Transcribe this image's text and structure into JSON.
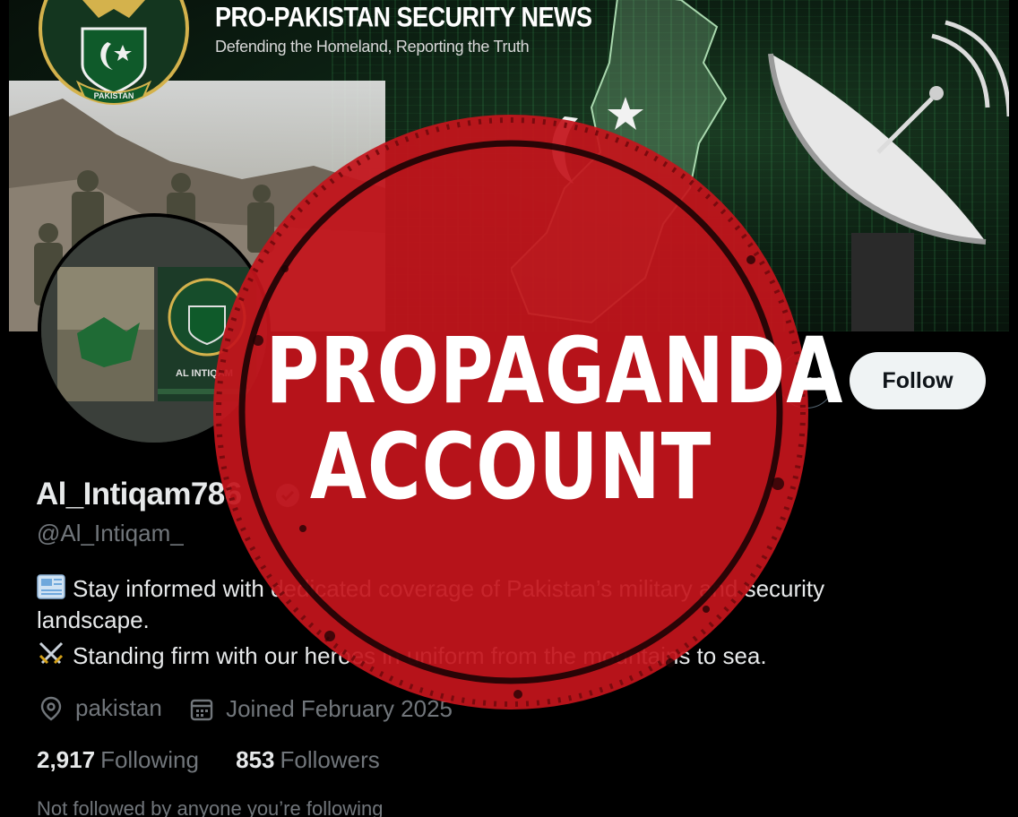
{
  "banner": {
    "title": "PRO-PAKISTAN SECURITY NEWS",
    "tagline": "Defending the Homeland, Reporting the Truth",
    "emblem_text": "PAKISTAN"
  },
  "avatar": {
    "label": "AL INTIQAM"
  },
  "profile": {
    "display_name": "Al_Intiqam786",
    "handle": "@Al_Intiqam_",
    "bio": {
      "line1": "Stay informed with dedicated coverage of Pakistan’s military and security",
      "line2": "landscape.",
      "line3": "Standing firm with our heroes in uniform from the mountains to  sea."
    },
    "location": "pakistan",
    "joined": "Joined February 2025",
    "following_count": "2,917",
    "following_label": "Following",
    "followers_count": "853",
    "followers_label": "Followers",
    "followed_note": "Not followed by anyone you’re following"
  },
  "actions": {
    "follow_label": "Follow",
    "more_label": "···"
  },
  "stamp": {
    "line1": "PROPAGANDA",
    "line2": "ACCOUNT"
  },
  "icons": {
    "bio_line1": "newspaper-icon",
    "bio_line3": "crossed-swords-icon",
    "location": "location-pin-icon",
    "joined": "calendar-icon",
    "verified": "verified-badge-icon"
  },
  "colors": {
    "background": "#000000",
    "text_primary": "#e7e9ea",
    "text_secondary": "#71767b",
    "follow_button_bg": "#eff3f4",
    "stamp_red": "#c4141c",
    "banner_green": "#1a3b22"
  }
}
